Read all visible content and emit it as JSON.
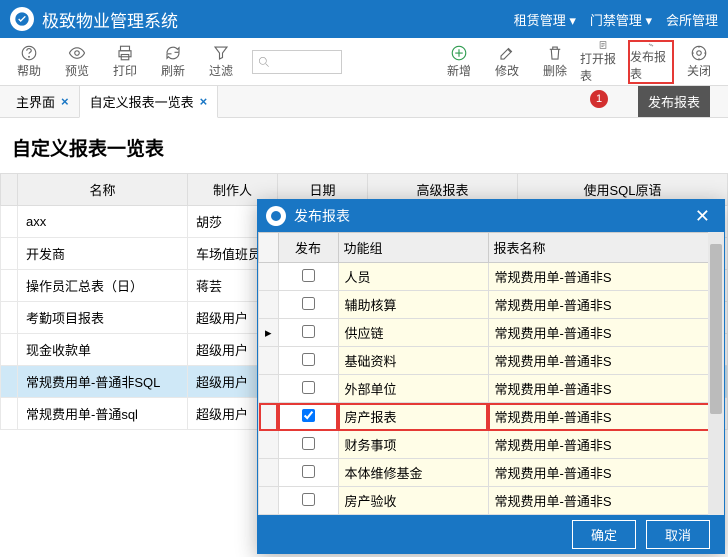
{
  "header": {
    "app_title": "极致物业管理系统",
    "menu": [
      "租赁管理 ▾",
      "门禁管理 ▾",
      "会所管理"
    ]
  },
  "toolbar": {
    "help": "帮助",
    "preview": "预览",
    "print": "打印",
    "refresh": "刷新",
    "filter": "过滤",
    "add": "新增",
    "edit": "修改",
    "delete": "删除",
    "open_report": "打开报表",
    "publish_report": "发布报表",
    "close": "关闭"
  },
  "tabs": {
    "main": "主界面",
    "active": "自定义报表一览表",
    "badge": "1",
    "tooltip": "发布报表"
  },
  "page_title": "自定义报表一览表",
  "main_columns": {
    "name": "名称",
    "author": "制作人",
    "date": "日期",
    "advanced": "高级报表",
    "sql": "使用SQL原语"
  },
  "main_rows": [
    {
      "name": "axx",
      "author": "胡莎"
    },
    {
      "name": "开发商",
      "author": "车场值班员"
    },
    {
      "name": "操作员汇总表（日）",
      "author": "蒋芸"
    },
    {
      "name": "考勤项目报表",
      "author": "超级用户"
    },
    {
      "name": "现金收款单",
      "author": "超级用户"
    },
    {
      "name": "常规费用单-普通非SQL",
      "author": "超级用户",
      "selected": true
    },
    {
      "name": "常规费用单-普通sql",
      "author": "超级用户"
    }
  ],
  "dialog": {
    "title": "发布报表",
    "columns": {
      "publish": "发布",
      "group": "功能组",
      "report_name": "报表名称"
    },
    "rows": [
      {
        "checked": false,
        "group": "人员",
        "name": "常规费用单-普通非S"
      },
      {
        "checked": false,
        "group": "辅助核算",
        "name": "常规费用单-普通非S"
      },
      {
        "checked": false,
        "group": "供应链",
        "name": "常规费用单-普通非S",
        "current": true
      },
      {
        "checked": false,
        "group": "基础资料",
        "name": "常规费用单-普通非S"
      },
      {
        "checked": false,
        "group": "外部单位",
        "name": "常规费用单-普通非S"
      },
      {
        "checked": true,
        "group": "房产报表",
        "name": "常规费用单-普通非S",
        "hl": true
      },
      {
        "checked": false,
        "group": "财务事项",
        "name": "常规费用单-普通非S"
      },
      {
        "checked": false,
        "group": "本体维修基金",
        "name": "常规费用单-普通非S"
      },
      {
        "checked": false,
        "group": "房产验收",
        "name": "常规费用单-普通非S"
      }
    ],
    "ok": "确定",
    "cancel": "取消"
  }
}
